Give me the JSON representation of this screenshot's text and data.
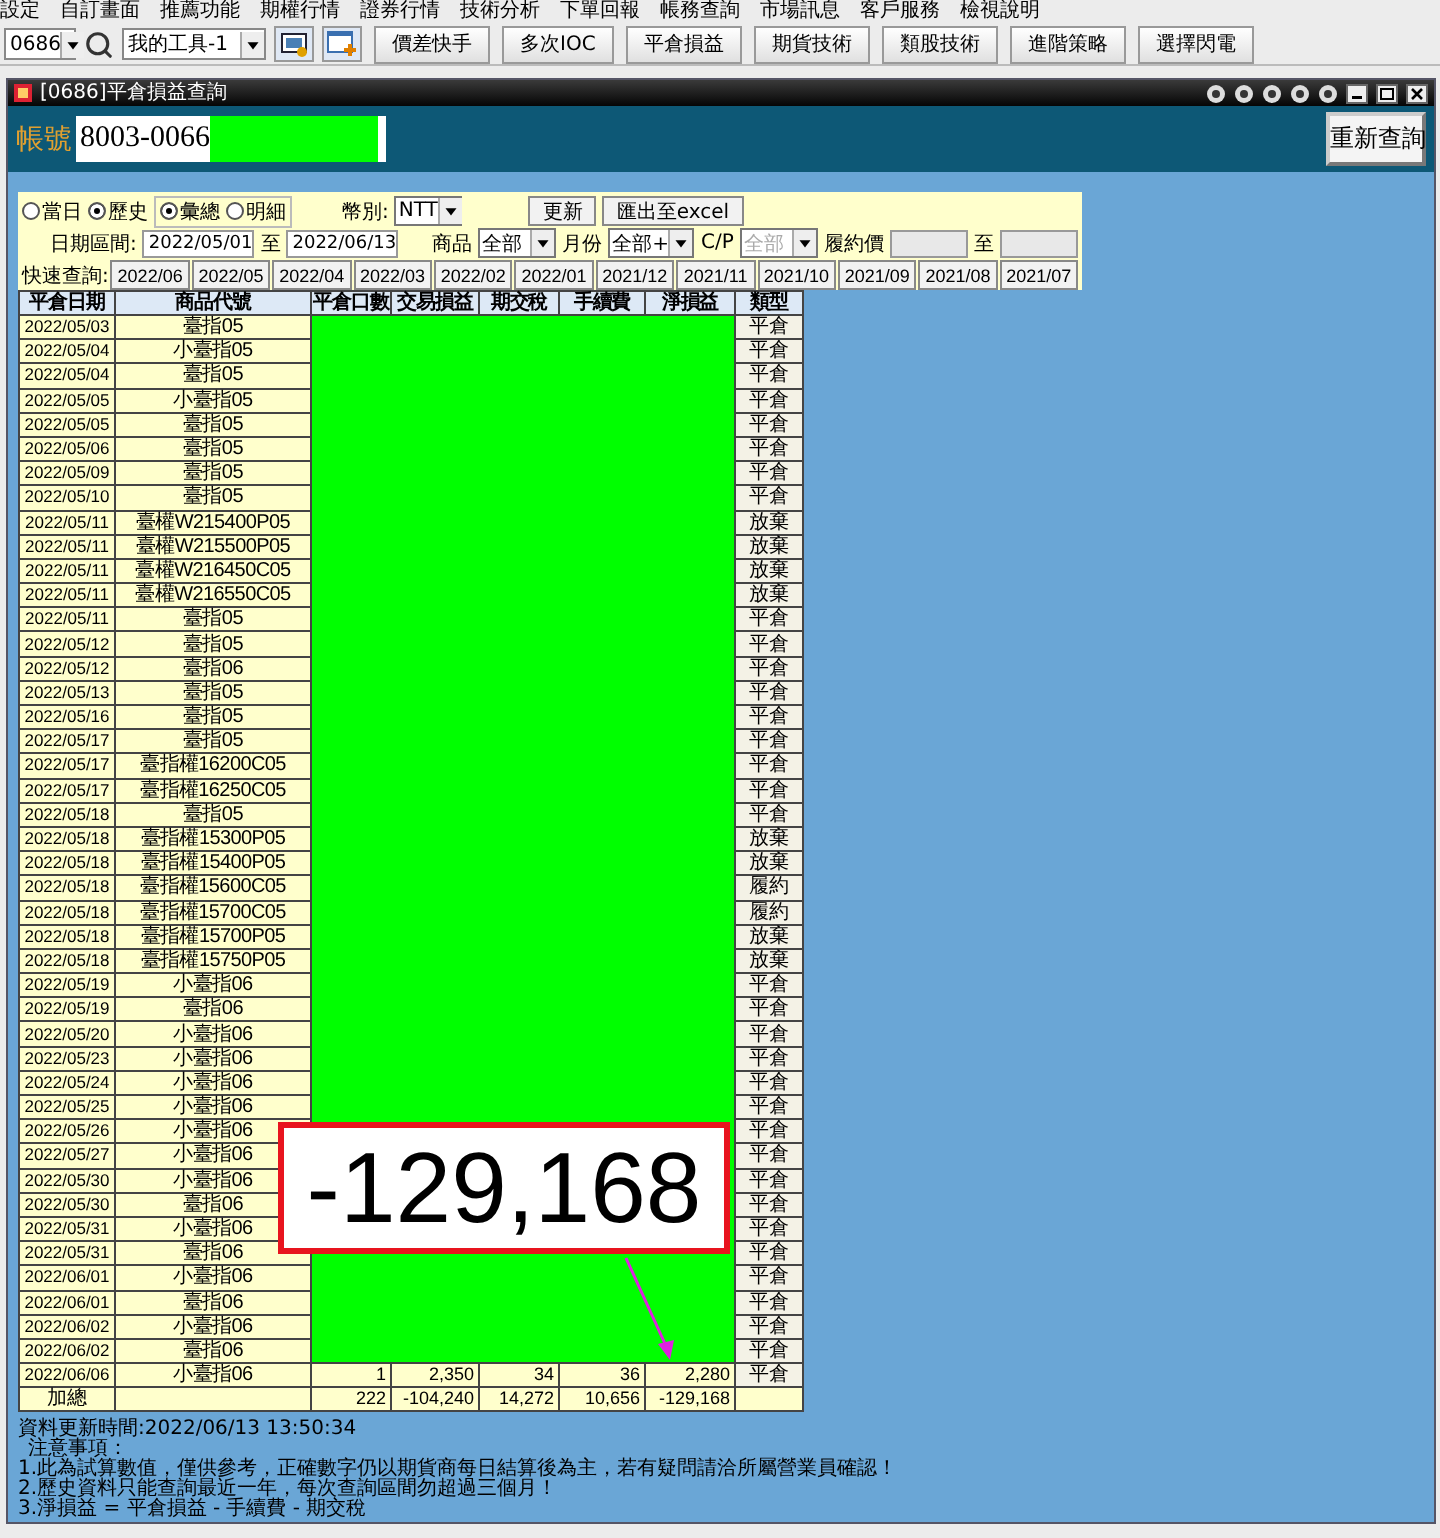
{
  "menu": [
    "設定",
    "自訂畫面",
    "推薦功能",
    "期權行情",
    "證券行情",
    "技術分析",
    "下單回報",
    "帳務查詢",
    "市場訊息",
    "客戶服務",
    "檢視說明"
  ],
  "toolbar": {
    "code": "0686",
    "tool": "我的工具-1",
    "buttons": [
      "價差快手",
      "多次IOC",
      "平倉損益",
      "期貨技術",
      "類股技術",
      "進階策略",
      "選擇閃電"
    ]
  },
  "window": {
    "title": "[0686]平倉損益查詢"
  },
  "account": {
    "label": "帳號",
    "value": "8003-0066",
    "requery": "重新查詢"
  },
  "filters": {
    "radio_groups": [
      [
        {
          "label": "當日",
          "selected": false
        },
        {
          "label": "歷史",
          "selected": true
        }
      ],
      [
        {
          "label": "彙總",
          "selected": true
        },
        {
          "label": "明細",
          "selected": false
        }
      ]
    ],
    "currency": {
      "label": "幣別:",
      "value": "NTT"
    },
    "buttons": [
      "更新",
      "匯出至excel"
    ],
    "date_label": "日期區間:",
    "date_from": "2022/05/01",
    "date_sep": "至",
    "date_to": "2022/06/13",
    "selects": [
      {
        "label": "商品",
        "value": "全部",
        "disabled": false
      },
      {
        "label": "月份",
        "value": "全部+",
        "disabled": false
      },
      {
        "label": "C/P",
        "value": "全部",
        "disabled": true
      }
    ],
    "strike_label": "履約價",
    "strike_sep": "至",
    "quick_label": "快速查詢:",
    "quick": [
      "2022/06",
      "2022/05",
      "2022/04",
      "2022/03",
      "2022/02",
      "2022/01",
      "2021/12",
      "2021/11",
      "2021/10",
      "2021/09",
      "2021/08",
      "2021/07"
    ]
  },
  "table": {
    "columns": [
      "平倉日期",
      "商品代號",
      "平倉口數",
      "交易損益",
      "期交稅",
      "手續費",
      "淨損益",
      "類型"
    ],
    "rows": [
      {
        "date": "2022/05/03",
        "product": "臺指05",
        "type": "平倉"
      },
      {
        "date": "2022/05/04",
        "product": "小臺指05",
        "type": "平倉"
      },
      {
        "date": "2022/05/04",
        "product": "臺指05",
        "type": "平倉"
      },
      {
        "date": "2022/05/05",
        "product": "小臺指05",
        "type": "平倉"
      },
      {
        "date": "2022/05/05",
        "product": "臺指05",
        "type": "平倉"
      },
      {
        "date": "2022/05/06",
        "product": "臺指05",
        "type": "平倉"
      },
      {
        "date": "2022/05/09",
        "product": "臺指05",
        "type": "平倉"
      },
      {
        "date": "2022/05/10",
        "product": "臺指05",
        "type": "平倉"
      },
      {
        "date": "2022/05/11",
        "product": "臺權W215400P05",
        "type": "放棄"
      },
      {
        "date": "2022/05/11",
        "product": "臺權W215500P05",
        "type": "放棄"
      },
      {
        "date": "2022/05/11",
        "product": "臺權W216450C05",
        "type": "放棄"
      },
      {
        "date": "2022/05/11",
        "product": "臺權W216550C05",
        "type": "放棄"
      },
      {
        "date": "2022/05/11",
        "product": "臺指05",
        "type": "平倉"
      },
      {
        "date": "2022/05/12",
        "product": "臺指05",
        "type": "平倉"
      },
      {
        "date": "2022/05/12",
        "product": "臺指06",
        "type": "平倉"
      },
      {
        "date": "2022/05/13",
        "product": "臺指05",
        "type": "平倉"
      },
      {
        "date": "2022/05/16",
        "product": "臺指05",
        "type": "平倉"
      },
      {
        "date": "2022/05/17",
        "product": "臺指05",
        "type": "平倉"
      },
      {
        "date": "2022/05/17",
        "product": "臺指權16200C05",
        "type": "平倉"
      },
      {
        "date": "2022/05/17",
        "product": "臺指權16250C05",
        "type": "平倉"
      },
      {
        "date": "2022/05/18",
        "product": "臺指05",
        "type": "平倉"
      },
      {
        "date": "2022/05/18",
        "product": "臺指權15300P05",
        "type": "放棄"
      },
      {
        "date": "2022/05/18",
        "product": "臺指權15400P05",
        "type": "放棄"
      },
      {
        "date": "2022/05/18",
        "product": "臺指權15600C05",
        "type": "履約"
      },
      {
        "date": "2022/05/18",
        "product": "臺指權15700C05",
        "type": "履約"
      },
      {
        "date": "2022/05/18",
        "product": "臺指權15700P05",
        "type": "放棄"
      },
      {
        "date": "2022/05/18",
        "product": "臺指權15750P05",
        "type": "放棄"
      },
      {
        "date": "2022/05/19",
        "product": "小臺指06",
        "type": "平倉"
      },
      {
        "date": "2022/05/19",
        "product": "臺指06",
        "type": "平倉"
      },
      {
        "date": "2022/05/20",
        "product": "小臺指06",
        "type": "平倉"
      },
      {
        "date": "2022/05/23",
        "product": "小臺指06",
        "type": "平倉"
      },
      {
        "date": "2022/05/24",
        "product": "小臺指06",
        "type": "平倉"
      },
      {
        "date": "2022/05/25",
        "product": "小臺指06",
        "type": "平倉"
      },
      {
        "date": "2022/05/26",
        "product": "小臺指06",
        "type": "平倉"
      },
      {
        "date": "2022/05/27",
        "product": "小臺指06",
        "type": "平倉"
      },
      {
        "date": "2022/05/30",
        "product": "小臺指06",
        "type": "平倉"
      },
      {
        "date": "2022/05/30",
        "product": "臺指06",
        "type": "平倉"
      },
      {
        "date": "2022/05/31",
        "product": "小臺指06",
        "type": "平倉"
      },
      {
        "date": "2022/05/31",
        "product": "臺指06",
        "type": "平倉"
      },
      {
        "date": "2022/06/01",
        "product": "小臺指06",
        "type": "平倉"
      },
      {
        "date": "2022/06/01",
        "product": "臺指06",
        "type": "平倉"
      },
      {
        "date": "2022/06/02",
        "product": "小臺指06",
        "type": "平倉"
      },
      {
        "date": "2022/06/02",
        "product": "臺指06",
        "type": "平倉"
      },
      {
        "date": "2022/06/06",
        "product": "小臺指06",
        "lots": "1",
        "trade_pl": "2,350",
        "tax": "34",
        "fee": "36",
        "net_pl": "2,280",
        "type": "平倉"
      }
    ],
    "total": {
      "label": "加總",
      "lots": "222",
      "trade_pl": "-104,240",
      "tax": "14,272",
      "fee": "10,656",
      "net_pl": "-129,168"
    }
  },
  "callout": "-129,168",
  "notes": [
    "資料更新時間:2022/06/13 13:50:34",
    "注意事項：",
    "1.此為試算數值，僅供參考，正確數字仍以期貨商每日結算後為主，若有疑問請洽所屬營業員確認！",
    "2.歷史資料只能查詢最近一年，每次查詢區間勿超過三個月！",
    "3.淨損益 = 平倉損益 - 手續費 - 期交稅"
  ]
}
